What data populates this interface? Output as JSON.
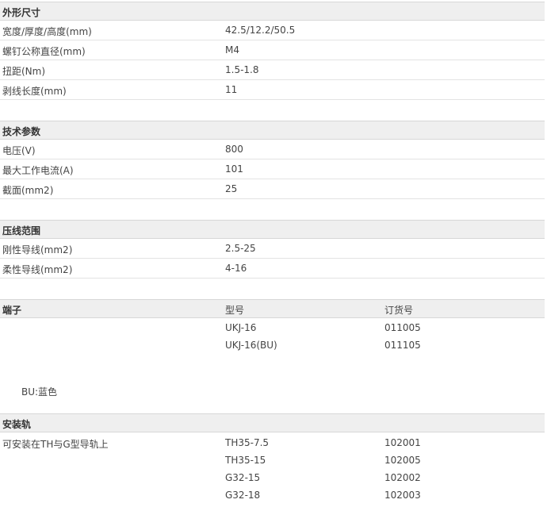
{
  "dimensions": {
    "title": "外形尺寸",
    "rows": [
      {
        "label": "宽度/厚度/高度(mm)",
        "value": "42.5/12.2/50.5"
      },
      {
        "label": "螺钉公称直径(mm)",
        "value": "M4"
      },
      {
        "label": "扭距(Nm)",
        "value": "1.5-1.8"
      },
      {
        "label": "剥线长度(mm)",
        "value": "11"
      }
    ]
  },
  "tech": {
    "title": "技术参数",
    "rows": [
      {
        "label": "电压(V)",
        "value": "800"
      },
      {
        "label": "最大工作电流(A)",
        "value": "101"
      },
      {
        "label": "截面(mm2)",
        "value": "25"
      }
    ]
  },
  "crimp": {
    "title": "压线范围",
    "rows": [
      {
        "label": "刚性导线(mm2)",
        "value": "2.5-25"
      },
      {
        "label": "柔性导线(mm2)",
        "value": "4-16"
      }
    ]
  },
  "terminal": {
    "title": "端子",
    "col_model": "型号",
    "col_order": "订货号",
    "items": [
      {
        "model": "UKJ-16",
        "order": "011005"
      },
      {
        "model": "UKJ-16(BU)",
        "order": "011105"
      }
    ],
    "note": "BU:蓝色"
  },
  "rail": {
    "title": "安装轨",
    "desc": "可安装在TH与G型导轨上",
    "items": [
      {
        "model": "TH35-7.5",
        "order": "102001"
      },
      {
        "model": "TH35-15",
        "order": "102005"
      },
      {
        "model": "G32-15",
        "order": "102002"
      },
      {
        "model": "G32-18",
        "order": "102003"
      }
    ]
  }
}
